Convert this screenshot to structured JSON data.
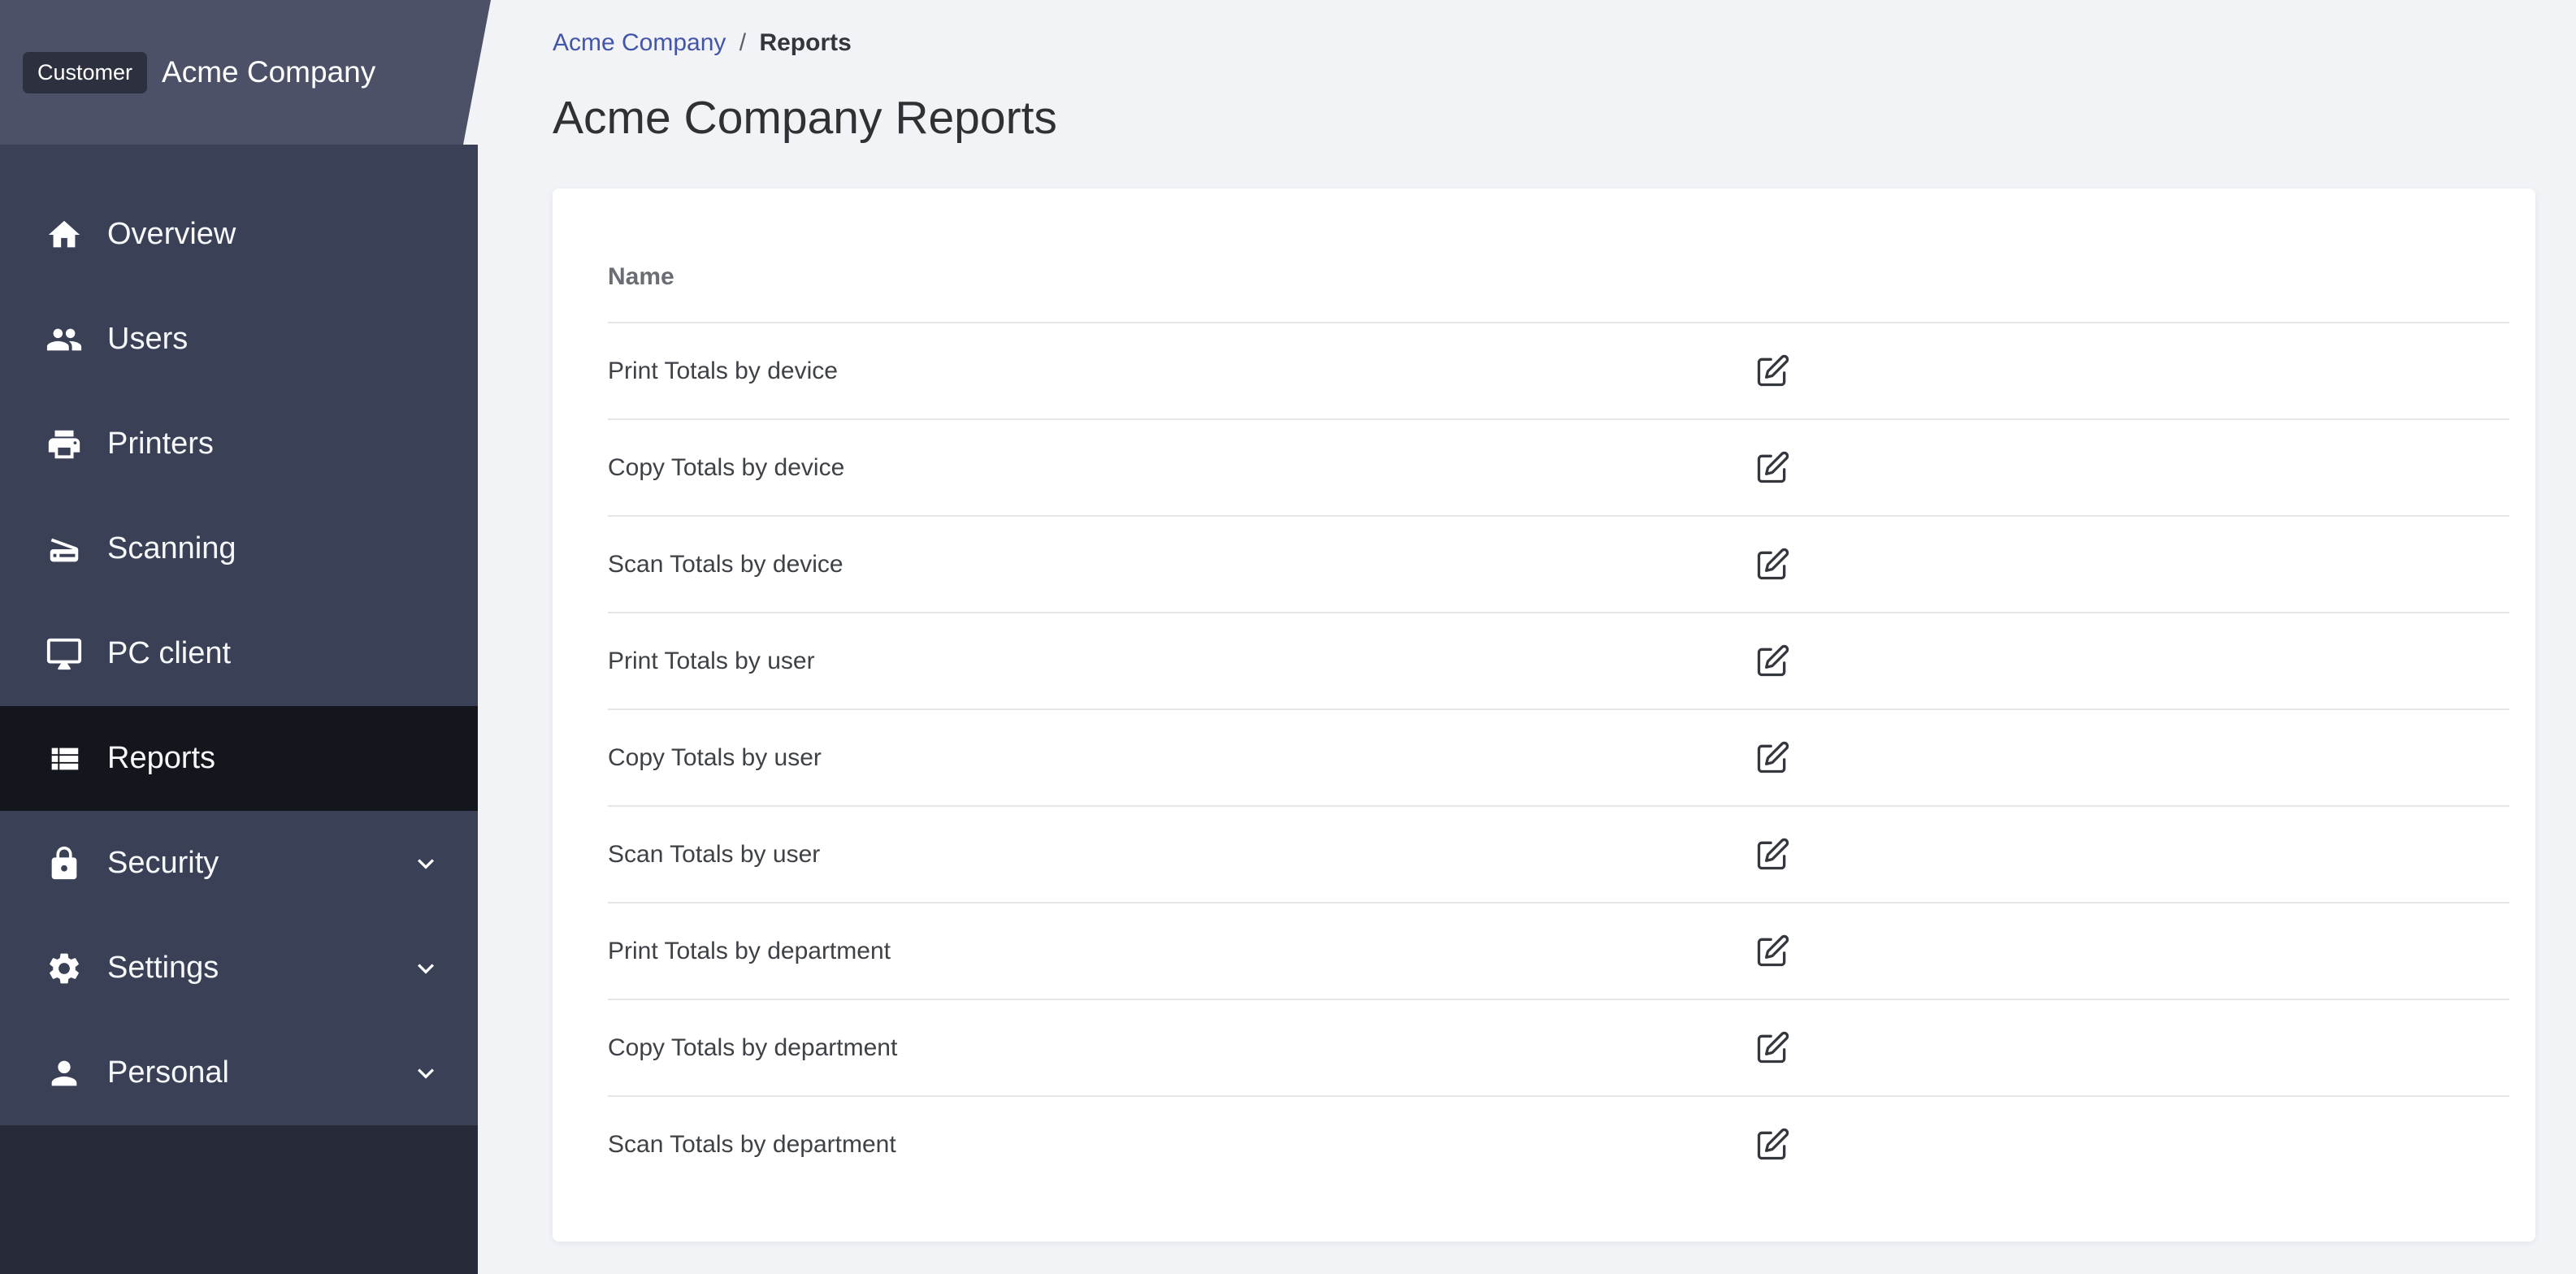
{
  "sidebar": {
    "customer_badge": "Customer",
    "company_name": "Acme Company",
    "items": [
      {
        "label": "Overview",
        "icon": "home",
        "active": false,
        "expandable": false
      },
      {
        "label": "Users",
        "icon": "users",
        "active": false,
        "expandable": false
      },
      {
        "label": "Printers",
        "icon": "printer",
        "active": false,
        "expandable": false
      },
      {
        "label": "Scanning",
        "icon": "scanner",
        "active": false,
        "expandable": false
      },
      {
        "label": "PC client",
        "icon": "monitor",
        "active": false,
        "expandable": false
      },
      {
        "label": "Reports",
        "icon": "table",
        "active": true,
        "expandable": false
      },
      {
        "label": "Security",
        "icon": "lock",
        "active": false,
        "expandable": true
      },
      {
        "label": "Settings",
        "icon": "gear",
        "active": false,
        "expandable": true
      },
      {
        "label": "Personal",
        "icon": "person",
        "active": false,
        "expandable": true
      }
    ]
  },
  "breadcrumb": {
    "parent": "Acme Company",
    "separator": "/",
    "current": "Reports"
  },
  "page": {
    "title": "Acme Company Reports"
  },
  "reports_table": {
    "name_column_header": "Name",
    "rows": [
      {
        "name": "Print Totals by device",
        "action_icon": "edit-icon"
      },
      {
        "name": "Copy Totals by device",
        "action_icon": "edit-icon"
      },
      {
        "name": "Scan Totals by device",
        "action_icon": "edit-icon"
      },
      {
        "name": "Print Totals by user",
        "action_icon": "edit-icon"
      },
      {
        "name": "Copy Totals by user",
        "action_icon": "edit-icon"
      },
      {
        "name": "Scan Totals by user",
        "action_icon": "edit-icon"
      },
      {
        "name": "Print Totals by department",
        "action_icon": "edit-icon"
      },
      {
        "name": "Copy Totals by department",
        "action_icon": "edit-icon"
      },
      {
        "name": "Scan Totals by department",
        "action_icon": "edit-icon"
      }
    ]
  },
  "colors": {
    "sidebar_header_bg": "#4c5168",
    "sidebar_nav_bg": "#3a4156",
    "sidebar_base_bg": "#272b39",
    "active_item_bg": "#14161d",
    "customer_badge_bg": "#2d303f",
    "breadcrumb_link": "#4355a8",
    "main_bg": "#f1f3f7",
    "card_bg": "#ffffff"
  }
}
